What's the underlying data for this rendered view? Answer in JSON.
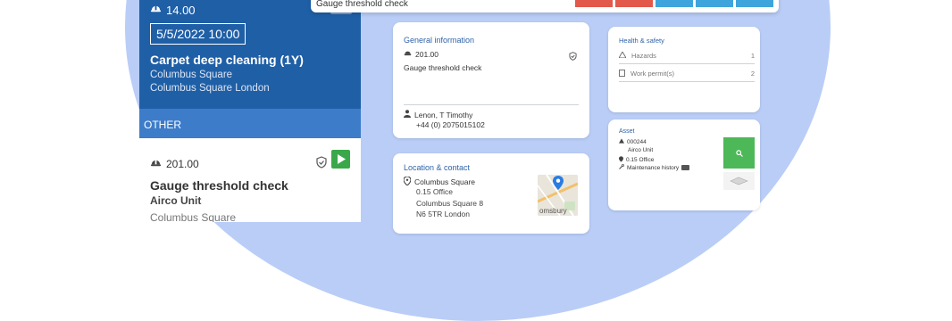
{
  "colors": {
    "primary": "#1f5fa6",
    "section": "#3d7cc9",
    "accent_green": "#4db858",
    "btn_red": "#e2584a",
    "btn_blue": "#3ea5dc",
    "background_blob": "#b9cdf7"
  },
  "phone": {
    "current_job": {
      "cost_icon": "helmet-icon",
      "cost": "14.00",
      "datetime": "5/5/2022 10:00",
      "title": "Carpet deep cleaning (1Y)",
      "location_line1": "Columbus Square",
      "location_line2": "Columbus Square London"
    },
    "section_label": "OTHER",
    "other_job": {
      "cost_icon": "helmet-icon",
      "cost": "201.00",
      "title": "Gauge threshold check",
      "subtitle": "Airco Unit",
      "location": "Columbus Square"
    }
  },
  "topbar": {
    "text": "Gauge threshold check",
    "buttons": [
      "red",
      "red",
      "blue",
      "blue",
      "blue"
    ]
  },
  "general_info": {
    "heading": "General information",
    "cost": "201.00",
    "description": "Gauge threshold check",
    "contact_name": "Lenon, T Timothy",
    "contact_phone": "+44 (0) 2075015102"
  },
  "location_contact": {
    "heading": "Location & contact",
    "place": "Columbus Square",
    "room": "0.15 Office",
    "address1": "Columbus Square 8",
    "address2": "N6 5TR London",
    "map_label": "omsbury"
  },
  "health_safety": {
    "heading": "Health & safety",
    "rows": [
      {
        "label": "Hazards",
        "count": "1",
        "icon": "warning-icon"
      },
      {
        "label": "Work permit(s)",
        "count": "2",
        "icon": "document-icon"
      }
    ]
  },
  "asset": {
    "heading": "Asset",
    "id": "000244",
    "name": "Airco Unit",
    "room": "0.15 Office",
    "history_label": "Maintenance history"
  }
}
